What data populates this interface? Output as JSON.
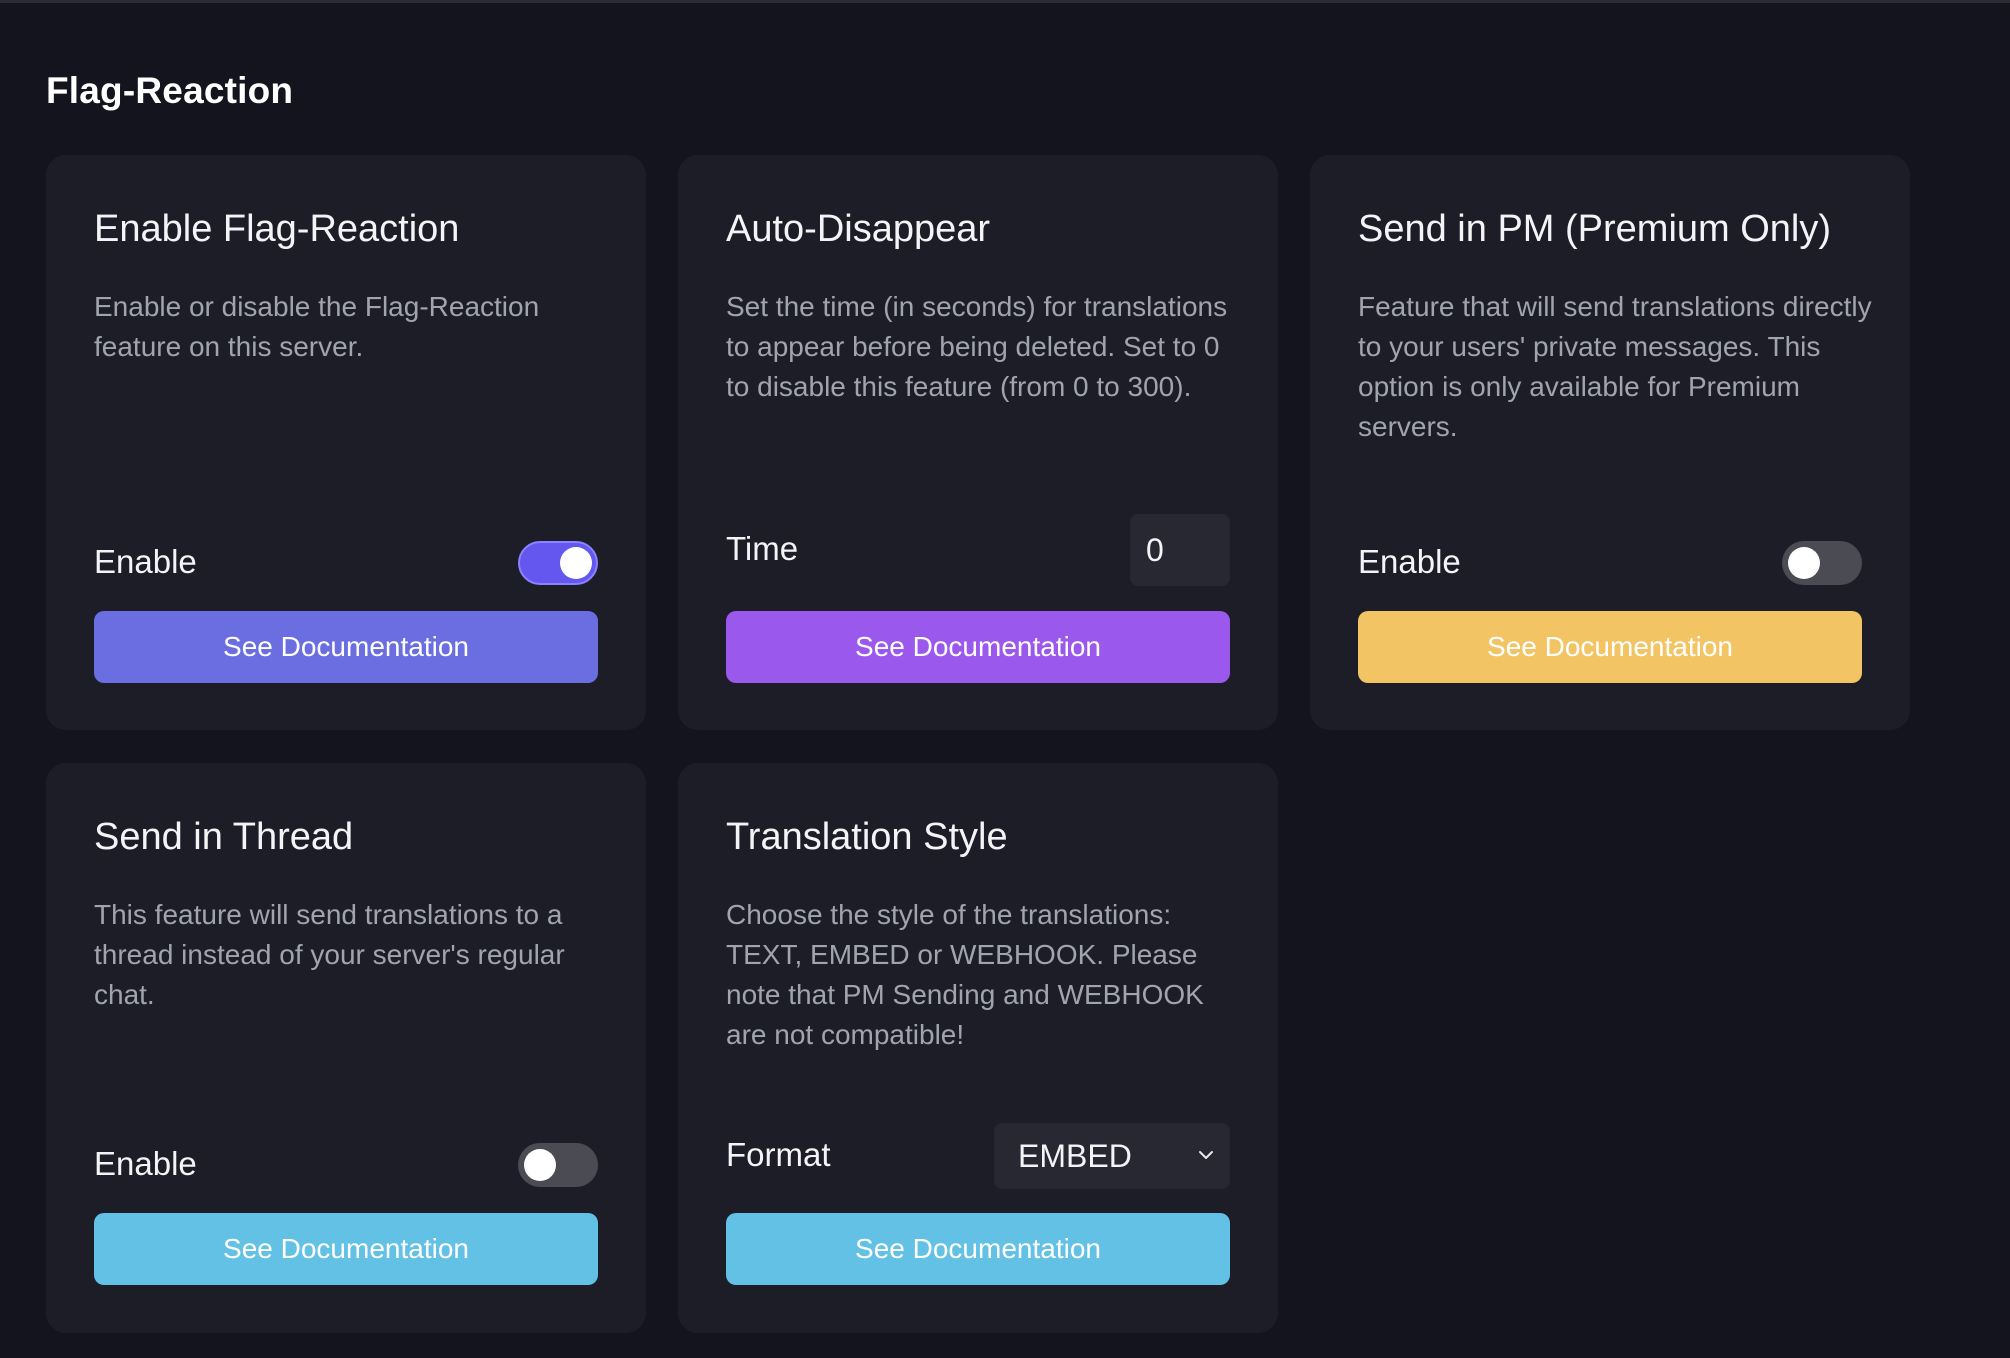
{
  "section": {
    "title": "Flag-Reaction"
  },
  "colors": {
    "background": "#13141d",
    "card": "#1c1d27",
    "indigo": "#6a6ee0",
    "purple": "#9b58ec",
    "yellow": "#f2c464",
    "sky": "#63c1e5",
    "toggle_on": "#6457f0"
  },
  "cards": [
    {
      "title": "Enable Flag-Reaction",
      "description": "Enable or disable the Flag-Reaction feature on this server.",
      "control_label": "Enable",
      "control_type": "toggle",
      "toggle_on": true,
      "button_label": "See Documentation"
    },
    {
      "title": "Auto-Disappear",
      "description": "Set the time (in seconds) for translations to appear before being deleted. Set to 0 to disable this feature (from 0 to 300).",
      "control_label": "Time",
      "control_type": "number",
      "value": "0",
      "button_label": "See Documentation"
    },
    {
      "title": "Send in PM (Premium Only)",
      "description": "Feature that will send translations directly to your users' private messages. This option is only available for Premium servers.",
      "control_label": "Enable",
      "control_type": "toggle",
      "toggle_on": false,
      "button_label": "See Documentation"
    },
    {
      "title": "Send in Thread",
      "description": "This feature will send translations to a thread instead of your server's regular chat.",
      "control_label": "Enable",
      "control_type": "toggle",
      "toggle_on": false,
      "button_label": "See Documentation"
    },
    {
      "title": "Translation Style",
      "description": "Choose the style of the translations: TEXT, EMBED or WEBHOOK. Please note that PM Sending and WEBHOOK are not compatible!",
      "control_label": "Format",
      "control_type": "select",
      "selected": "EMBED",
      "button_label": "See Documentation"
    }
  ],
  "icons": {
    "select_arrow": "chevron-down-icon"
  }
}
